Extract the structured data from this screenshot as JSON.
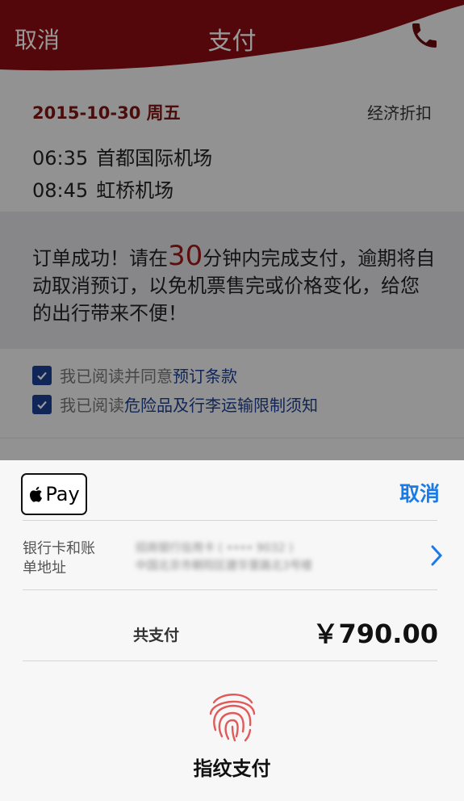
{
  "header": {
    "cancel_label": "取消",
    "title": "支付",
    "phone_icon": "phone-icon",
    "brand_color": "#8a0c12"
  },
  "flight": {
    "date": "2015-10-30 周五",
    "fare_class": "经济折扣",
    "departure": {
      "time": "06:35",
      "airport": "首都国际机场"
    },
    "arrival": {
      "time": "08:45",
      "airport": "虹桥机场"
    }
  },
  "notice": {
    "text_before": "订单成功！请在",
    "minutes": "30",
    "text_after": "分钟内完成支付，逾期将自动取消预订，以免机票售完或价格变化，给您的出行带来不便！"
  },
  "agreements": [
    {
      "prefix": "我已阅读并同意",
      "link": "预订条款",
      "checked": true
    },
    {
      "prefix": "我已阅读",
      "link": "危险品及行李运输限制须知",
      "checked": true
    }
  ],
  "payment_sheet": {
    "applepay_label": "Pay",
    "cancel_label": "取消",
    "card_label": "银行卡和账单地址",
    "card_line1": "招商银行信用卡 ( •••• 9032 )",
    "card_line2": "中国北京市朝阳区建华里路北3号楼",
    "total_label": "共支付",
    "total_amount": "￥790.00",
    "touch_label": "指纹支付",
    "accent_color": "#1a7ae6"
  }
}
